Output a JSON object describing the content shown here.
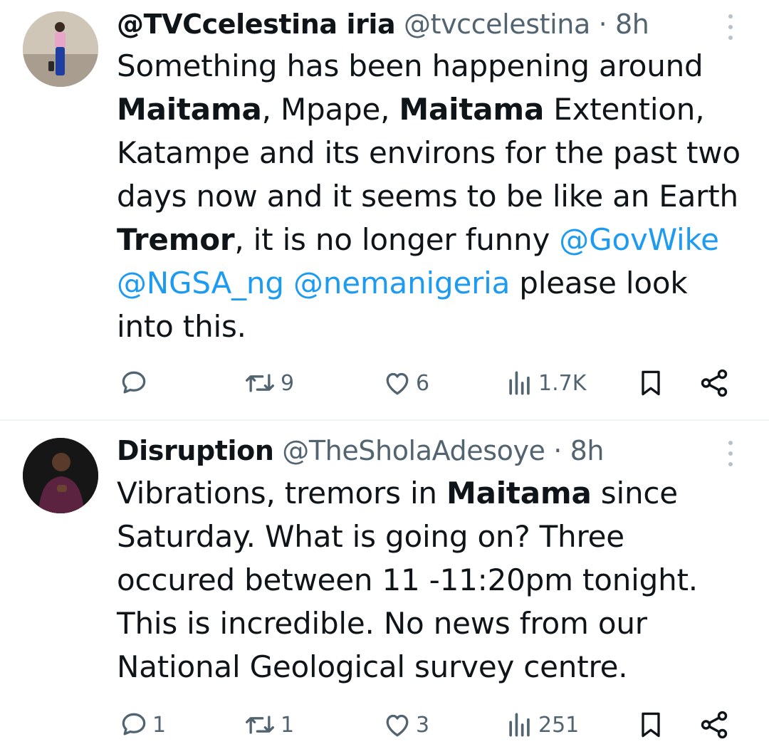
{
  "tweets": [
    {
      "display_name": "@TVCcelestina iria",
      "handle": "@tvccelestina",
      "separator": "·",
      "time": "8h",
      "body": [
        {
          "t": "Something has been happening around "
        },
        {
          "t": "Maitama",
          "b": true
        },
        {
          "t": ", Mpape, "
        },
        {
          "t": "Maitama",
          "b": true
        },
        {
          "t": " Extention, Katampe and its environs for the past two days now and it seems to be like an Earth "
        },
        {
          "t": "Tremor",
          "b": true
        },
        {
          "t": ", it is no longer funny "
        },
        {
          "t": "@GovWike",
          "m": true
        },
        {
          "t": " "
        },
        {
          "t": "@NGSA_ng",
          "m": true
        },
        {
          "t": " "
        },
        {
          "t": "@nemanigeria",
          "m": true
        },
        {
          "t": " please look into this."
        }
      ],
      "replies": "",
      "retweets": "9",
      "likes": "6",
      "views": "1.7K"
    },
    {
      "display_name": "Disruption",
      "handle": "@TheSholaAdesoye",
      "separator": "·",
      "time": "8h",
      "body": [
        {
          "t": "Vibrations, tremors in "
        },
        {
          "t": "Maitama",
          "b": true
        },
        {
          "t": " since Saturday. What is going on? Three occured between 11 -11:20pm tonight. This is incredible. No news from our National Geological survey centre."
        }
      ],
      "replies": "1",
      "retweets": "1",
      "likes": "3",
      "views": "251"
    }
  ],
  "icons": {
    "reply": "reply-icon",
    "retweet": "retweet-icon",
    "like": "heart-icon",
    "views": "views-bar-chart-icon",
    "bookmark": "bookmark-icon",
    "share": "share-icon",
    "more": "more-vertical-icon"
  },
  "colors": {
    "text": "#0f1419",
    "secondary": "#536471",
    "mention": "#1d9bf0",
    "divider": "#eff3f4"
  }
}
